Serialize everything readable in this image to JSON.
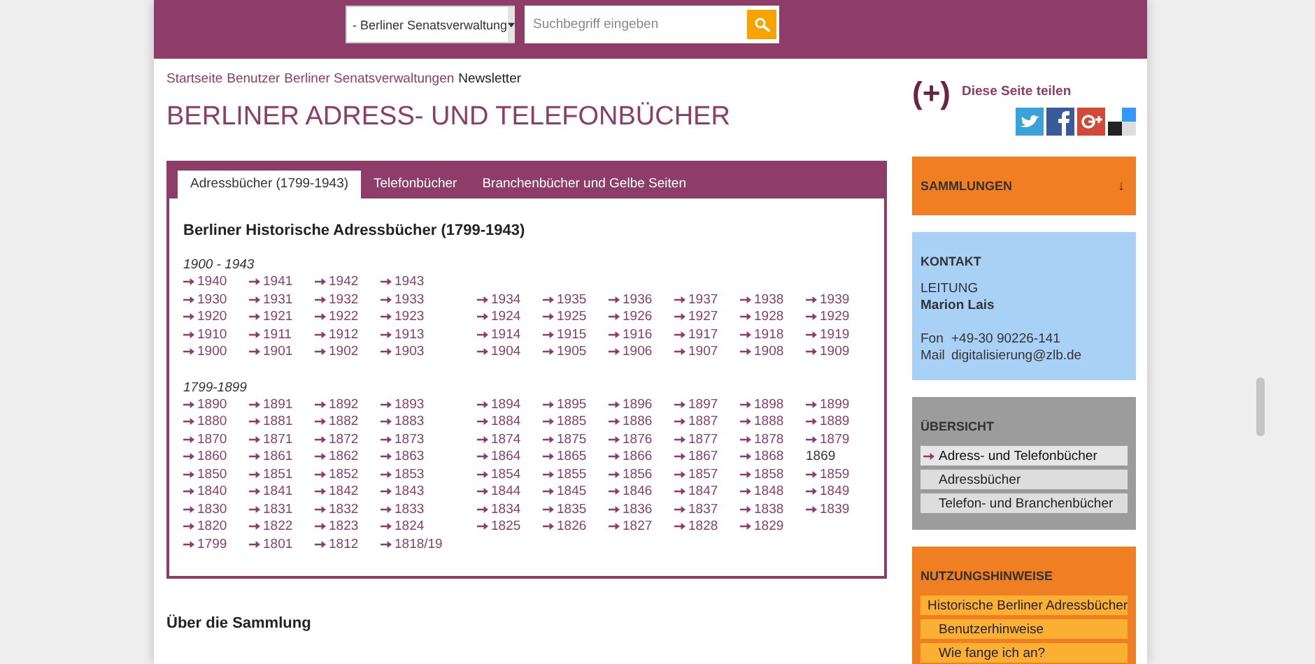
{
  "header": {
    "scope_select": {
      "value": "- Berliner Senatsverwaltung"
    },
    "search": {
      "placeholder": "Suchbegriff eingeben"
    }
  },
  "breadcrumb": [
    {
      "label": "Startseite",
      "link": true
    },
    {
      "label": "Benutzer",
      "link": true
    },
    {
      "label": "Berliner Senatsverwaltungen",
      "link": true
    },
    {
      "label": "Newsletter",
      "link": false
    }
  ],
  "page_title": "BERLINER ADRESS- UND TELEFONBÜCHER",
  "tabs": [
    {
      "label": "Adressbücher (1799-1943)",
      "selected": true
    },
    {
      "label": "Telefonbücher",
      "selected": false
    },
    {
      "label": "Branchenbücher und Gelbe Seiten",
      "selected": false
    }
  ],
  "panel_heading": "Berliner Historische Adressbücher (1799-1943)",
  "sections": [
    {
      "title": "1900 - 1943",
      "rows": [
        {
          "left": [
            {
              "text": "1940",
              "link": true
            },
            {
              "text": "1941",
              "link": true
            },
            {
              "text": "1942",
              "link": true
            },
            {
              "text": "1943",
              "link": true
            }
          ],
          "right": []
        },
        {
          "left": [
            {
              "text": "1930",
              "link": true
            },
            {
              "text": "1931",
              "link": true
            },
            {
              "text": "1932",
              "link": true
            },
            {
              "text": "1933",
              "link": true
            }
          ],
          "right": [
            {
              "text": "1934",
              "link": true
            },
            {
              "text": "1935",
              "link": true
            },
            {
              "text": "1936",
              "link": true
            },
            {
              "text": "1937",
              "link": true
            },
            {
              "text": "1938",
              "link": true
            },
            {
              "text": "1939",
              "link": true
            }
          ]
        },
        {
          "left": [
            {
              "text": "1920",
              "link": true
            },
            {
              "text": "1921",
              "link": true
            },
            {
              "text": "1922",
              "link": true
            },
            {
              "text": "1923",
              "link": true
            }
          ],
          "right": [
            {
              "text": "1924",
              "link": true
            },
            {
              "text": "1925",
              "link": true
            },
            {
              "text": "1926",
              "link": true
            },
            {
              "text": "1927",
              "link": true
            },
            {
              "text": "1928",
              "link": true
            },
            {
              "text": "1929",
              "link": true
            }
          ]
        },
        {
          "left": [
            {
              "text": "1910",
              "link": true
            },
            {
              "text": "1911",
              "link": true
            },
            {
              "text": "1912",
              "link": true
            },
            {
              "text": "1913",
              "link": true
            }
          ],
          "right": [
            {
              "text": "1914",
              "link": true
            },
            {
              "text": "1915",
              "link": true
            },
            {
              "text": "1916",
              "link": true
            },
            {
              "text": "1917",
              "link": true
            },
            {
              "text": "1918",
              "link": true
            },
            {
              "text": "1919",
              "link": true
            }
          ]
        },
        {
          "left": [
            {
              "text": "1900",
              "link": true
            },
            {
              "text": "1901",
              "link": true
            },
            {
              "text": "1902",
              "link": true
            },
            {
              "text": "1903",
              "link": true
            }
          ],
          "right": [
            {
              "text": "1904",
              "link": true
            },
            {
              "text": "1905",
              "link": true
            },
            {
              "text": "1906",
              "link": true
            },
            {
              "text": "1907",
              "link": true
            },
            {
              "text": "1908",
              "link": true
            },
            {
              "text": "1909",
              "link": true
            }
          ]
        }
      ]
    },
    {
      "title": "1799-1899",
      "rows": [
        {
          "left": [
            {
              "text": "1890",
              "link": true
            },
            {
              "text": "1891",
              "link": true
            },
            {
              "text": "1892",
              "link": true
            },
            {
              "text": "1893",
              "link": true
            }
          ],
          "right": [
            {
              "text": "1894",
              "link": true
            },
            {
              "text": "1895",
              "link": true
            },
            {
              "text": "1896",
              "link": true
            },
            {
              "text": "1897",
              "link": true
            },
            {
              "text": "1898",
              "link": true
            },
            {
              "text": "1899",
              "link": true
            }
          ]
        },
        {
          "left": [
            {
              "text": "1880",
              "link": true
            },
            {
              "text": "1881",
              "link": true
            },
            {
              "text": "1882",
              "link": true
            },
            {
              "text": "1883",
              "link": true
            }
          ],
          "right": [
            {
              "text": "1884",
              "link": true
            },
            {
              "text": "1885",
              "link": true
            },
            {
              "text": "1886",
              "link": true
            },
            {
              "text": "1887",
              "link": true
            },
            {
              "text": "1888",
              "link": true
            },
            {
              "text": "1889",
              "link": true
            }
          ]
        },
        {
          "left": [
            {
              "text": "1870",
              "link": true
            },
            {
              "text": "1871",
              "link": true
            },
            {
              "text": "1872",
              "link": true
            },
            {
              "text": "1873",
              "link": true
            }
          ],
          "right": [
            {
              "text": "1874",
              "link": true
            },
            {
              "text": "1875",
              "link": true
            },
            {
              "text": "1876",
              "link": true
            },
            {
              "text": "1877",
              "link": true
            },
            {
              "text": "1878",
              "link": true
            },
            {
              "text": "1879",
              "link": true
            }
          ]
        },
        {
          "left": [
            {
              "text": "1860",
              "link": true
            },
            {
              "text": "1861",
              "link": true
            },
            {
              "text": "1862",
              "link": true
            },
            {
              "text": "1863",
              "link": true
            }
          ],
          "right": [
            {
              "text": "1864",
              "link": true
            },
            {
              "text": "1865",
              "link": true
            },
            {
              "text": "1866",
              "link": true
            },
            {
              "text": "1867",
              "link": true
            },
            {
              "text": "1868",
              "link": true
            },
            {
              "text": "1869",
              "link": false
            }
          ]
        },
        {
          "left": [
            {
              "text": "1850",
              "link": true
            },
            {
              "text": "1851",
              "link": true
            },
            {
              "text": "1852",
              "link": true
            },
            {
              "text": "1853",
              "link": true
            }
          ],
          "right": [
            {
              "text": "1854",
              "link": true
            },
            {
              "text": "1855",
              "link": true
            },
            {
              "text": "1856",
              "link": true
            },
            {
              "text": "1857",
              "link": true
            },
            {
              "text": "1858",
              "link": true
            },
            {
              "text": "1859",
              "link": true
            }
          ]
        },
        {
          "left": [
            {
              "text": "1840",
              "link": true
            },
            {
              "text": "1841",
              "link": true
            },
            {
              "text": "1842",
              "link": true
            },
            {
              "text": "1843",
              "link": true
            }
          ],
          "right": [
            {
              "text": "1844",
              "link": true
            },
            {
              "text": "1845",
              "link": true
            },
            {
              "text": "1846",
              "link": true
            },
            {
              "text": "1847",
              "link": true
            },
            {
              "text": "1848",
              "link": true
            },
            {
              "text": "1849",
              "link": true
            }
          ]
        },
        {
          "left": [
            {
              "text": "1830",
              "link": true
            },
            {
              "text": "1831",
              "link": true
            },
            {
              "text": "1832",
              "link": true
            },
            {
              "text": "1833",
              "link": true
            }
          ],
          "right": [
            {
              "text": "1834",
              "link": true
            },
            {
              "text": "1835",
              "link": true
            },
            {
              "text": "1836",
              "link": true
            },
            {
              "text": "1837",
              "link": true
            },
            {
              "text": "1838",
              "link": true
            },
            {
              "text": "1839",
              "link": true
            }
          ]
        },
        {
          "left": [
            {
              "text": "1820",
              "link": true
            },
            {
              "text": "1822",
              "link": true
            },
            {
              "text": "1823",
              "link": true
            },
            {
              "text": "1824",
              "link": true
            }
          ],
          "right": [
            {
              "text": "1825",
              "link": true
            },
            {
              "text": "1826",
              "link": true
            },
            {
              "text": "1827",
              "link": true
            },
            {
              "text": "1828",
              "link": true
            },
            {
              "text": "1829",
              "link": true
            }
          ]
        },
        {
          "left": [
            {
              "text": "1799",
              "link": true
            },
            {
              "text": "1801",
              "link": true
            },
            {
              "text": "1812",
              "link": true
            },
            {
              "text": "1818/19",
              "link": true
            }
          ],
          "right": []
        }
      ]
    }
  ],
  "about_heading": "Über die Sammlung",
  "share": {
    "symbol": "(+)",
    "label": "Diese Seite teilen"
  },
  "sidebar": [
    {
      "kind": "collapsible",
      "title": "SAMMLUNGEN",
      "toggle": "↓"
    },
    {
      "kind": "contact",
      "title": "KONTAKT",
      "role": "LEITUNG",
      "person": "Marion Lais",
      "lines": [
        {
          "label": "Fon",
          "value": "+49-30 90226-141"
        },
        {
          "label": "Mail",
          "value": "digitalisierung@zlb.de"
        }
      ]
    },
    {
      "kind": "menu",
      "title": "ÜBERSICHT",
      "items": [
        {
          "label": "Adress- und Telefonbücher",
          "selected": true
        },
        {
          "label": "Adressbücher",
          "selected": false
        },
        {
          "label": "Telefon- und Branchenbücher",
          "selected": false
        }
      ]
    },
    {
      "kind": "menu-orange",
      "title": "NUTZUNGSHINWEISE",
      "items": [
        {
          "label": "Historische Berliner Adressbücher"
        },
        {
          "label": "Benutzerhinweise"
        },
        {
          "label": "Wie fange ich an?"
        }
      ]
    }
  ]
}
